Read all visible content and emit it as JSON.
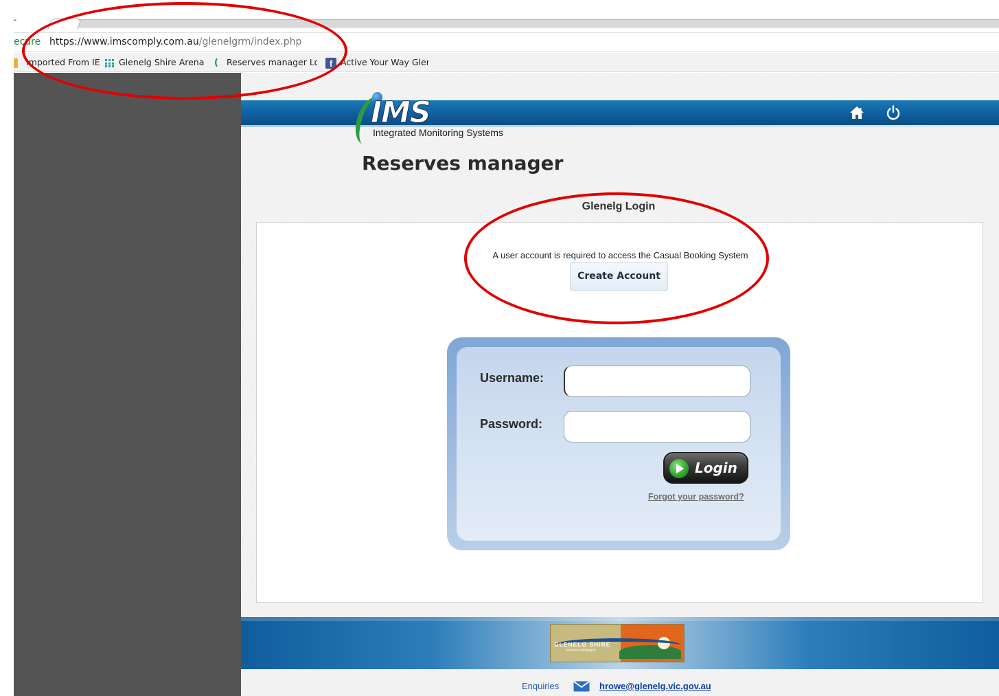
{
  "browser": {
    "security_label": "ecure",
    "url_host": "https://www.imscomply.com.au",
    "url_path": "/glenelgrm/index.php",
    "bookmarks": [
      {
        "label": "Imported From IE",
        "icon": "folder-icon"
      },
      {
        "label": "Glenelg Shire Arena",
        "icon": "grid-icon"
      },
      {
        "label": "Reserves manager Lo",
        "icon": "ims-icon"
      },
      {
        "label": "Active Your Way Gler",
        "icon": "facebook-icon"
      }
    ]
  },
  "header": {
    "logo_text": "IMS",
    "logo_tagline": "Integrated Monitoring Systems",
    "app_title": "Reserves manager",
    "icons": [
      "home-icon",
      "power-icon"
    ]
  },
  "login": {
    "heading": "Glenelg Login",
    "notice": "A user account is required to access the Casual Booking System",
    "create_account_label": "Create Account",
    "username_label": "Username:",
    "password_label": "Password:",
    "username_value": "",
    "password_value": "",
    "login_button_label": "Login",
    "forgot_password_label": "Forgot your password?"
  },
  "footer": {
    "shire_logo_text": "GLENELG SHIRE",
    "shire_logo_subtext": "Victoria's Birthplace",
    "enquiries_label": "Enquiries",
    "email": "hrowe@glenelg.vic.gov.au"
  },
  "colors": {
    "header_blue": "#0f5f9e",
    "annotation_red": "#e10000",
    "sidebar_gray": "#545454",
    "logo_green": "#2d9b43"
  }
}
